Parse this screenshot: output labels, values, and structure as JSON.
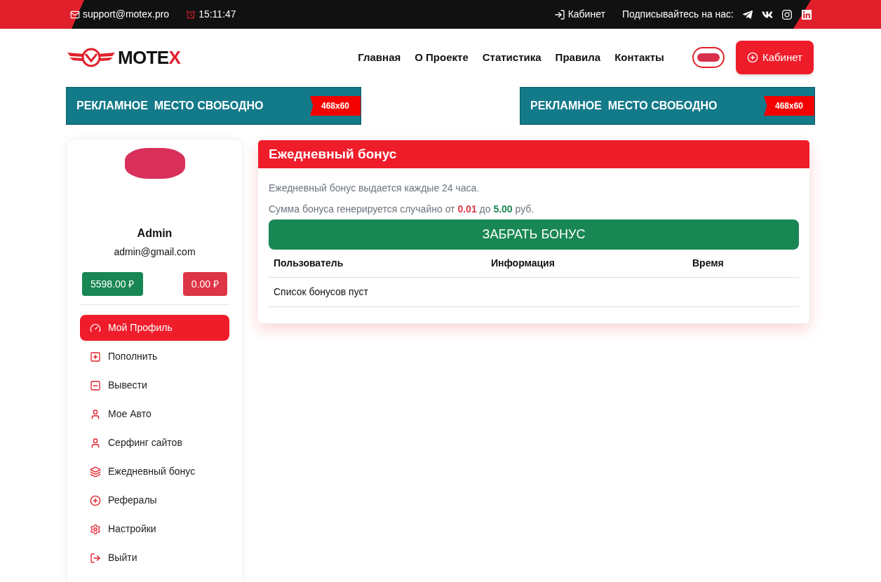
{
  "topbar": {
    "email": "support@motex.pro",
    "time": "15:11:47",
    "cabinet": "Кабинет",
    "subscribe": "Подписывайтесь на нас:",
    "socials": [
      {
        "kind": "telegram"
      },
      {
        "kind": "vk"
      },
      {
        "kind": "instagram"
      },
      {
        "kind": "linkedin"
      }
    ]
  },
  "header": {
    "logo": {
      "main": "MOTE",
      "accent": "X"
    },
    "nav": [
      "Главная",
      "О Проекте",
      "Статистика",
      "Правила",
      "Контакты"
    ],
    "cabinet_button": "Кабинет"
  },
  "banners": [
    {
      "text": "РЕКЛАМНОЕ  МЕСТО СВОБОДНО",
      "size": "468x60"
    },
    {
      "text": "РЕКЛАМНОЕ  МЕСТО СВОБОДНО",
      "size": "468x60"
    }
  ],
  "profile": {
    "name": "Admin",
    "email": "admin@gmail.com",
    "balances": [
      {
        "value": "5598.00 ₽",
        "color": "#198754"
      },
      {
        "value": "0.00 ₽",
        "color": "#dc3545"
      }
    ]
  },
  "menu": [
    {
      "label": "Мой Профиль",
      "kind": "profile",
      "selected": true
    },
    {
      "label": "Пополнить",
      "kind": "deposit",
      "selected": false
    },
    {
      "label": "Вывести",
      "kind": "withdraw",
      "selected": false
    },
    {
      "label": "Мое Авто",
      "kind": "car",
      "selected": false
    },
    {
      "label": "Серфинг сайтов",
      "kind": "surfing",
      "selected": false
    },
    {
      "label": "Ежедневный бонус",
      "kind": "bonus",
      "selected": false
    },
    {
      "label": "Рефералы",
      "kind": "referrals",
      "selected": false
    },
    {
      "label": "Настройки",
      "kind": "settings",
      "selected": false
    },
    {
      "label": "Выйти",
      "kind": "logout",
      "selected": false
    }
  ],
  "bonus": {
    "title": "Ежедневный бонус",
    "info": "Ежедневный бонус выдается каждые 24 часа.",
    "sentence": [
      {
        "kind": "plain",
        "text": "Сумма бонуса генерируется случайно от "
      },
      {
        "kind": "min",
        "text": "0.01"
      },
      {
        "kind": "plain",
        "text": " до "
      },
      {
        "kind": "max",
        "text": "5.00"
      },
      {
        "kind": "plain",
        "text": " руб."
      }
    ],
    "button": "ЗАБРАТЬ БОНУС",
    "table": {
      "columns": [
        "Пользователь",
        "Информация",
        "Время"
      ],
      "empty": "Список бонусов пуст"
    }
  }
}
